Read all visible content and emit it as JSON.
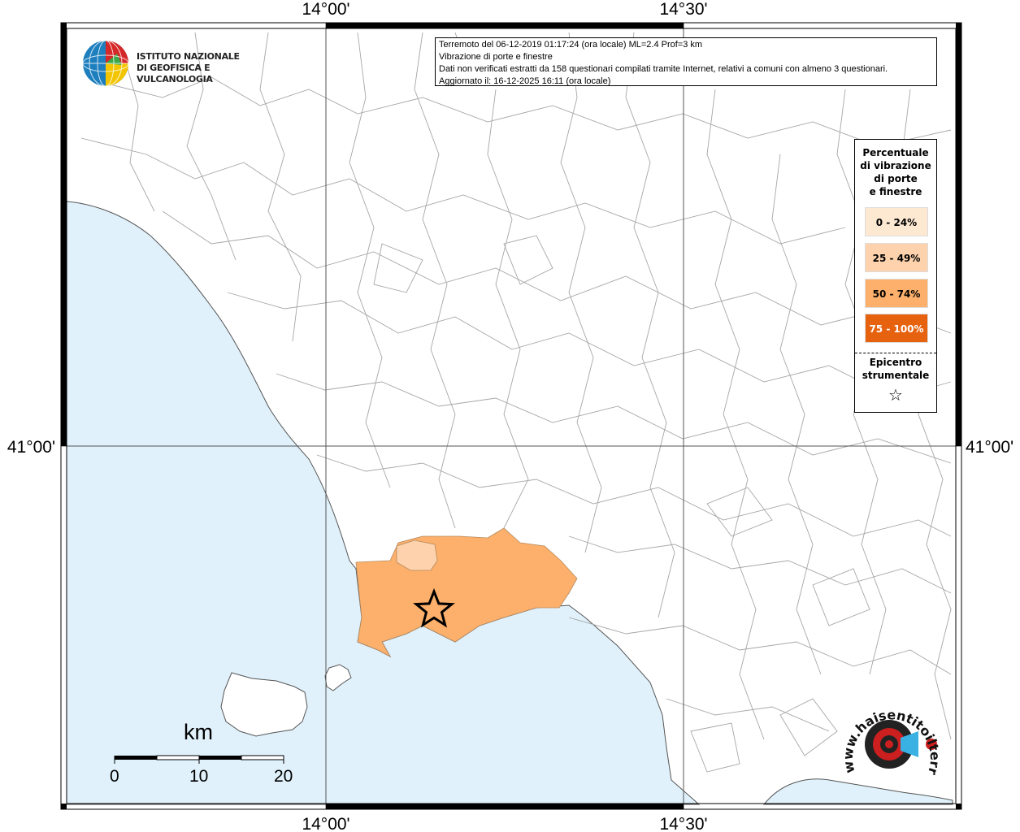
{
  "map": {
    "lon_labels": [
      "14°00'",
      "14°30'"
    ],
    "lat_label": "41°00'",
    "colors": {
      "sea": "#e0f1fb",
      "land": "#ffffff",
      "borders": "#9a9a9a",
      "frame": "#000000",
      "class_0_24": "#fde8d2",
      "class_25_49": "#fdd2ac",
      "class_50_74": "#fcb06b",
      "class_75_100": "#e6620f"
    },
    "epicenter_icon": "star-icon"
  },
  "info": {
    "line1": "Terremoto del 06-12-2019 01:17:24 (ora locale) ML=2.4 Prof=3 km",
    "line2": "Vibrazione di porte e finestre",
    "line3": "Dati non verificati estratti da 158 questionari compilati tramite Internet, relativi a comuni con almeno 3 questionari.",
    "line4": "Aggiornato il: 16-12-2025 16:11 (ora locale)"
  },
  "legend": {
    "title": [
      "Percentuale",
      "di vibrazione",
      "di porte",
      "e finestre"
    ],
    "items": [
      {
        "label": "0 - 24%",
        "color": "#fde8d2",
        "text_color": "#000000"
      },
      {
        "label": "25 - 49%",
        "color": "#fdd2ac",
        "text_color": "#000000"
      },
      {
        "label": "50 - 74%",
        "color": "#fcb06b",
        "text_color": "#000000"
      },
      {
        "label": "75 - 100%",
        "color": "#e6620f",
        "text_color": "#ffffff"
      }
    ],
    "epicenter_label": [
      "Epicentro",
      "strumentale"
    ],
    "epicenter_symbol": "☆"
  },
  "logo": {
    "line1": "ISTITUTO NAZIONALE",
    "line2": "DI GEOFISICA E VULCANOLOGIA"
  },
  "scale": {
    "unit": "km",
    "ticks": [
      "0",
      "10",
      "20"
    ]
  },
  "brand": {
    "text": "www.haisentitoilterremoto.it"
  }
}
